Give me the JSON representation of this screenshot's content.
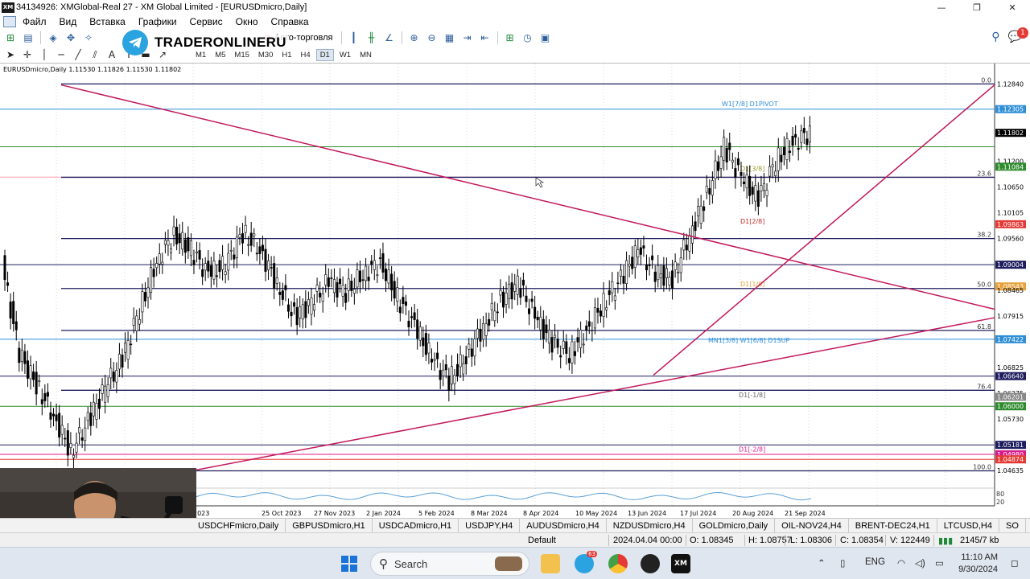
{
  "window": {
    "title": "34134926: XMGlobal-Real 27 - XM Global Limited - [EURUSDmicro,Daily]",
    "app_icon": "XM",
    "minimize": "—",
    "restore": "❐",
    "close": "✕"
  },
  "menu": [
    "Файл",
    "Вид",
    "Вставка",
    "Графики",
    "Сервис",
    "Окно",
    "Справка"
  ],
  "toolbar": {
    "autotrade_label": "Авто-торговля",
    "timeframes": [
      "M1",
      "M5",
      "M15",
      "M30",
      "H1",
      "H4",
      "D1",
      "W1",
      "MN"
    ],
    "active_timeframe": "D1"
  },
  "overlay_logo": "TRADERONLINERU",
  "notification_count": "1",
  "chart": {
    "symbol_header": "EURUSDmicro,Daily  1.11530 1.11826 1.11530 1.11802",
    "price_labels": [
      "1.12840",
      "1.12305",
      "1.11802",
      "1.11200",
      "1.11084",
      "1.10650",
      "1.10105",
      "1.09863",
      "1.09560",
      "1.09004",
      "1.08543",
      "1.08465",
      "1.07915",
      "1.07422",
      "1.06825",
      "1.06640",
      "1.06275",
      "1.06201",
      "1.06000",
      "1.05730",
      "1.05181",
      "1.04980",
      "1.04874",
      "1.04635"
    ],
    "date_labels": [
      "2023",
      "25 Oct 2023",
      "27 Nov 2023",
      "2 Jan 2024",
      "5 Feb 2024",
      "8 Mar 2024",
      "8 Apr 2024",
      "10 May 2024",
      "13 Jun 2024",
      "17 Jul 2024",
      "20 Aug 2024",
      "21 Sep 2024"
    ],
    "fib_labels": [
      "0.0",
      "23.6",
      "38.2",
      "50.0",
      "61.8",
      "76.4",
      "100.0"
    ],
    "level_labels": [
      "W1[7/8] D1PIVOT",
      "D1[3/8]",
      "D1[2/8]",
      "D1[1/8]",
      "MN1[3/8] W1[6/8] D1SUP",
      "D1[-1/8]",
      "D1[-2/8]"
    ],
    "indicator_labels": [
      "80",
      "20"
    ],
    "colors": {
      "bull": "#000000",
      "trendline": "#c2185b",
      "fib": "#1c1c5e",
      "green": "#2e8b2e",
      "blue": "#2f8fd6",
      "red": "#e53935",
      "magenta": "#d81b8c",
      "orange": "#e6a23c"
    }
  },
  "chart_data": {
    "type": "candlestick",
    "symbol": "EURUSDmicro",
    "timeframe": "Daily",
    "ohlc_current": {
      "open": 1.1153,
      "high": 1.11826,
      "low": 1.1153,
      "close": 1.11802
    },
    "ylim": [
      1.044,
      1.13
    ],
    "x_ticks": [
      "2023",
      "25 Oct 2023",
      "27 Nov 2023",
      "2 Jan 2024",
      "5 Feb 2024",
      "8 Mar 2024",
      "8 Apr 2024",
      "10 May 2024",
      "13 Jun 2024",
      "17 Jul 2024",
      "20 Aug 2024",
      "21 Sep 2024"
    ],
    "horizontal_levels": [
      1.12305,
      1.11506,
      1.10863,
      1.09004,
      1.07422,
      1.0664,
      1.06,
      1.05181,
      1.0498,
      1.04874
    ],
    "fibonacci": [
      {
        "ratio": "0.0",
        "price": 1.1284
      },
      {
        "ratio": "23.6",
        "price": 1.1086
      },
      {
        "ratio": "38.2",
        "price": 1.0956
      },
      {
        "ratio": "50.0",
        "price": 1.085
      },
      {
        "ratio": "61.8",
        "price": 1.0761
      },
      {
        "ratio": "76.4",
        "price": 1.0634
      },
      {
        "ratio": "100.0",
        "price": 1.0463
      }
    ],
    "series": [
      {
        "name": "EURUSDmicro,Daily",
        "close": [
          1.0712,
          1.0645,
          1.058,
          1.0503,
          1.0567,
          1.064,
          1.07,
          1.0805,
          1.0908,
          1.0965,
          1.093,
          1.088,
          1.09,
          1.0968,
          1.0932,
          1.086,
          1.079,
          1.082,
          1.0865,
          1.0842,
          1.088,
          1.0905,
          1.083,
          1.077,
          1.0701,
          1.0655,
          1.0705,
          1.077,
          1.0825,
          1.086,
          1.079,
          1.0735,
          1.071,
          1.076,
          1.082,
          1.087,
          1.0932,
          1.0883,
          1.087,
          1.0965,
          1.105,
          1.115,
          1.1085,
          1.104,
          1.112,
          1.116,
          1.118
        ]
      }
    ]
  },
  "tabs": [
    "USDCHFmicro,Daily",
    "GBPUSDmicro,H1",
    "USDCADmicro,H1",
    "USDJPY,H4",
    "AUDUSDmicro,H4",
    "NZDUSDmicro,H4",
    "GOLDmicro,Daily",
    "OIL-NOV24,H4",
    "BRENT-DEC24,H1",
    "LTCUSD,H4",
    "SO"
  ],
  "status": {
    "profile": "Default",
    "datetime": "2024.04.04 00:00",
    "open": "O: 1.08345",
    "high": "H: 1.08757",
    "low": "L: 1.08306",
    "close": "C: 1.08354",
    "volume": "V: 122449",
    "traffic": "2145/7 kb"
  },
  "taskbar": {
    "search_placeholder": "Search",
    "language": "ENG",
    "time": "11:10 AM",
    "date": "9/30/2024",
    "xm_label": "XM",
    "telegram_badge": "63"
  }
}
